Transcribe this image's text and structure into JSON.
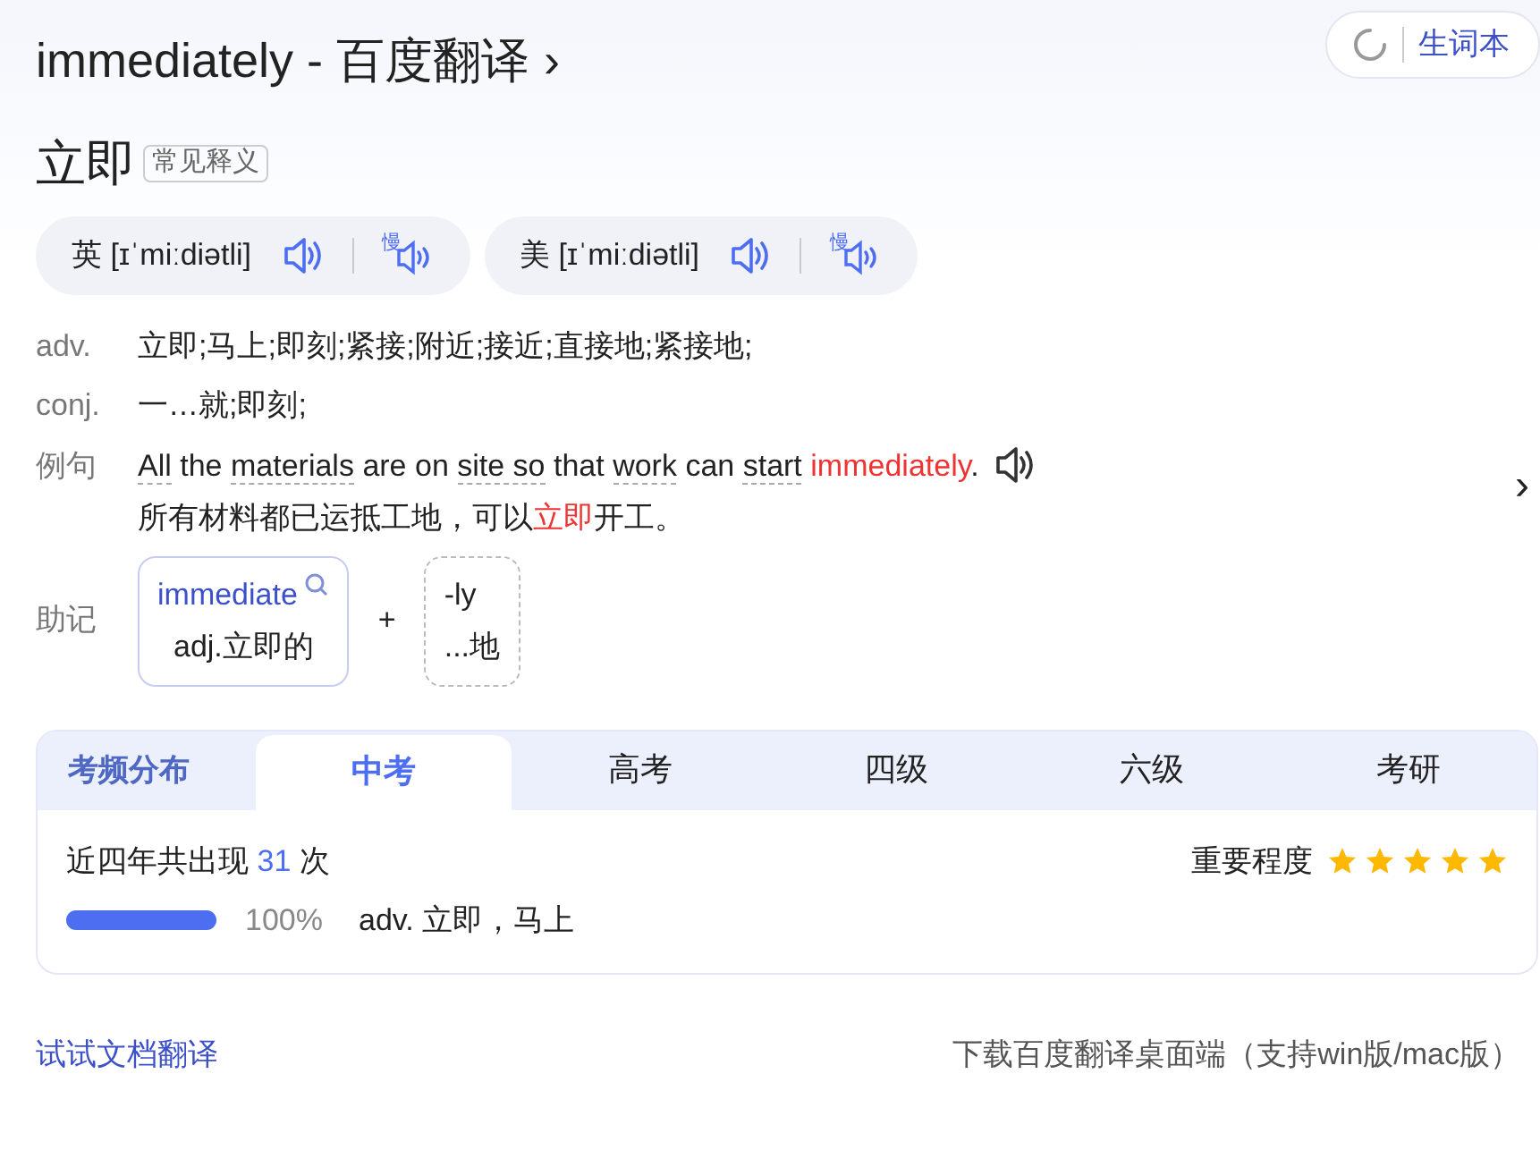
{
  "header": {
    "title": "immediately - 百度翻译",
    "chevron": "›",
    "vocab_button": "生词本"
  },
  "headword": {
    "text": "立即",
    "tag": "常见释义"
  },
  "pronunciations": [
    {
      "region": "英",
      "phonetic": "[ɪˈmiːdiətli]",
      "slow_label": "慢"
    },
    {
      "region": "美",
      "phonetic": "[ɪˈmiːdiətli]",
      "slow_label": "慢"
    }
  ],
  "definitions": [
    {
      "pos": "adv.",
      "meaning": "立即;马上;即刻;紧接;附近;接近;直接地;紧接地;"
    },
    {
      "pos": "conj.",
      "meaning": "一…就;即刻;"
    }
  ],
  "example": {
    "label": "例句",
    "sentence": [
      {
        "kind": "linked",
        "text": "All"
      },
      {
        "kind": "plain",
        "text": " the "
      },
      {
        "kind": "linked",
        "text": "materials"
      },
      {
        "kind": "plain",
        "text": " are on "
      },
      {
        "kind": "linked",
        "text": "site so"
      },
      {
        "kind": "plain",
        "text": " that "
      },
      {
        "kind": "linked",
        "text": "work"
      },
      {
        "kind": "plain",
        "text": " can "
      },
      {
        "kind": "linked",
        "text": "start"
      },
      {
        "kind": "highlight",
        "text": "immediately"
      },
      {
        "kind": "plain",
        "text": "."
      }
    ],
    "translation": [
      {
        "kind": "plain",
        "text": "所有材料都已运抵工地，可以"
      },
      {
        "kind": "highlight",
        "text": "立即"
      },
      {
        "kind": "plain",
        "text": "开工。"
      }
    ],
    "next": "›"
  },
  "mnemonic": {
    "label": "助记",
    "parts": [
      {
        "kind": "root",
        "word": "immediate",
        "gloss": "adj.立即的"
      },
      {
        "kind": "suffix",
        "word": "-ly",
        "gloss": "...地"
      }
    ],
    "plus": "+"
  },
  "exam": {
    "heading": "考频分布",
    "tabs": [
      {
        "label": "中考",
        "selected": true
      },
      {
        "label": "高考",
        "selected": false
      },
      {
        "label": "四级",
        "selected": false
      },
      {
        "label": "六级",
        "selected": false
      },
      {
        "label": "考研",
        "selected": false
      }
    ],
    "count_prefix": "近四年共出现",
    "count": "31",
    "count_suffix": "次",
    "importance_label": "重要程度",
    "stars": 5,
    "senses": [
      {
        "level": 1.0,
        "percent": "100%",
        "meaning": "adv. 立即，马上"
      }
    ]
  },
  "footer": {
    "doc_link": "试试文档翻译",
    "download": "下载百度翻译桌面端（支持win版/mac版）"
  }
}
